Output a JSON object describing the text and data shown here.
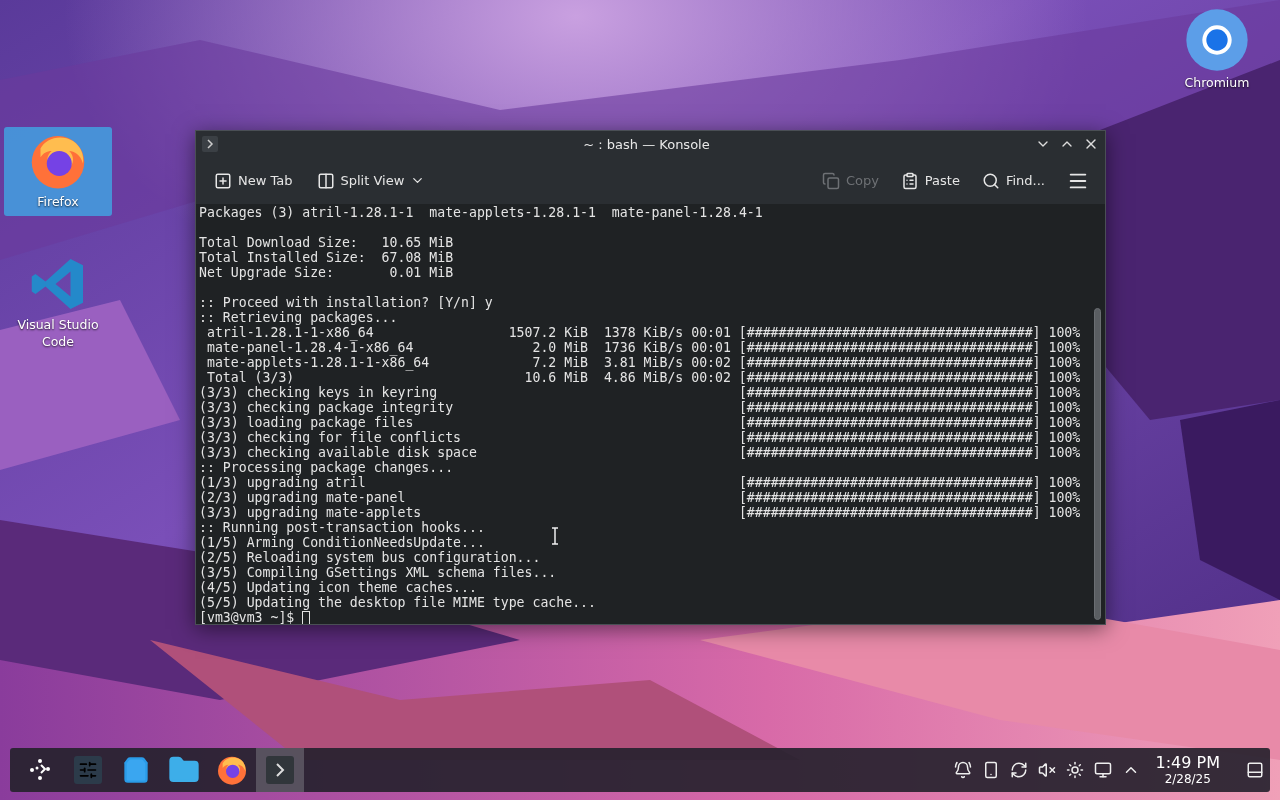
{
  "desktop_icons": [
    {
      "label": "Firefox",
      "kind": "firefox",
      "selected": true
    },
    {
      "label": "Visual Studio Code",
      "kind": "vscode",
      "selected": false
    },
    {
      "label": "Chromium",
      "kind": "chromium",
      "selected": false
    }
  ],
  "window": {
    "title": "~ : bash — Konsole",
    "toolbar": [
      {
        "label": "New Tab",
        "kind": "new-tab",
        "disabled": false
      },
      {
        "label": "Split View",
        "kind": "split-view",
        "disabled": false
      },
      {
        "label": "Copy",
        "kind": "copy",
        "disabled": true
      },
      {
        "label": "Paste",
        "kind": "paste",
        "disabled": false
      },
      {
        "label": "Find...",
        "kind": "find",
        "disabled": false
      }
    ],
    "terminal": [
      {
        "kind": "text",
        "text": "Packages (3) atril-1.28.1-1  mate-applets-1.28.1-1  mate-panel-1.28.4-1"
      },
      {
        "kind": "blank"
      },
      {
        "kind": "text",
        "text": "Total Download Size:   10.65 MiB"
      },
      {
        "kind": "text",
        "text": "Total Installed Size:  67.08 MiB"
      },
      {
        "kind": "text",
        "text": "Net Upgrade Size:       0.01 MiB"
      },
      {
        "kind": "blank"
      },
      {
        "kind": "text",
        "text": ":: Proceed with installation? [Y/n] y"
      },
      {
        "kind": "text",
        "text": ":: Retrieving packages..."
      },
      {
        "kind": "download",
        "name": "atril-1.28.1-1-x86_64",
        "size": "1507.2 KiB",
        "rate": "1378 KiB/s",
        "time": "00:01",
        "bar": "[####################################]",
        "percent": "100%"
      },
      {
        "kind": "download",
        "name": "mate-panel-1.28.4-1-x86_64",
        "size": "2.0 MiB",
        "rate": "1736 KiB/s",
        "time": "00:01",
        "bar": "[####################################]",
        "percent": "100%"
      },
      {
        "kind": "download",
        "name": "mate-applets-1.28.1-1-x86_64",
        "size": "7.2 MiB",
        "rate": "3.81 MiB/s",
        "time": "00:02",
        "bar": "[####################################]",
        "percent": "100%"
      },
      {
        "kind": "download",
        "name": "Total (3/3)",
        "size": "10.6 MiB",
        "rate": "4.86 MiB/s",
        "time": "00:02",
        "bar": "[####################################]",
        "percent": "100%"
      },
      {
        "kind": "step",
        "name": "(3/3) checking keys in keyring",
        "bar": "[####################################]",
        "percent": "100%"
      },
      {
        "kind": "step",
        "name": "(3/3) checking package integrity",
        "bar": "[####################################]",
        "percent": "100%"
      },
      {
        "kind": "step",
        "name": "(3/3) loading package files",
        "bar": "[####################################]",
        "percent": "100%"
      },
      {
        "kind": "step",
        "name": "(3/3) checking for file conflicts",
        "bar": "[####################################]",
        "percent": "100%"
      },
      {
        "kind": "step",
        "name": "(3/3) checking available disk space",
        "bar": "[####################################]",
        "percent": "100%"
      },
      {
        "kind": "text",
        "text": ":: Processing package changes..."
      },
      {
        "kind": "step",
        "name": "(1/3) upgrading atril",
        "bar": "[####################################]",
        "percent": "100%"
      },
      {
        "kind": "step",
        "name": "(2/3) upgrading mate-panel",
        "bar": "[####################################]",
        "percent": "100%"
      },
      {
        "kind": "step",
        "name": "(3/3) upgrading mate-applets",
        "bar": "[####################################]",
        "percent": "100%"
      },
      {
        "kind": "text",
        "text": ":: Running post-transaction hooks..."
      },
      {
        "kind": "text",
        "text": "(1/5) Arming ConditionNeedsUpdate..."
      },
      {
        "kind": "text",
        "text": "(2/5) Reloading system bus configuration..."
      },
      {
        "kind": "text",
        "text": "(3/5) Compiling GSettings XML schema files..."
      },
      {
        "kind": "text",
        "text": "(4/5) Updating icon theme caches..."
      },
      {
        "kind": "text",
        "text": "(5/5) Updating the desktop file MIME type cache..."
      },
      {
        "kind": "prompt",
        "text": "[vm3@vm3 ~]$ "
      }
    ]
  },
  "taskbar": {
    "apps": [
      {
        "kind": "launcher",
        "active": false
      },
      {
        "kind": "settings",
        "active": false
      },
      {
        "kind": "store",
        "active": false
      },
      {
        "kind": "files",
        "active": false
      },
      {
        "kind": "firefox",
        "active": false
      },
      {
        "kind": "konsole",
        "active": true
      }
    ],
    "tray": [
      {
        "kind": "notifications"
      },
      {
        "kind": "connect"
      },
      {
        "kind": "updates"
      },
      {
        "kind": "volume-muted"
      },
      {
        "kind": "brightness"
      },
      {
        "kind": "network"
      },
      {
        "kind": "expand"
      }
    ],
    "time": "1:49 PM",
    "date": "2/28/25"
  }
}
